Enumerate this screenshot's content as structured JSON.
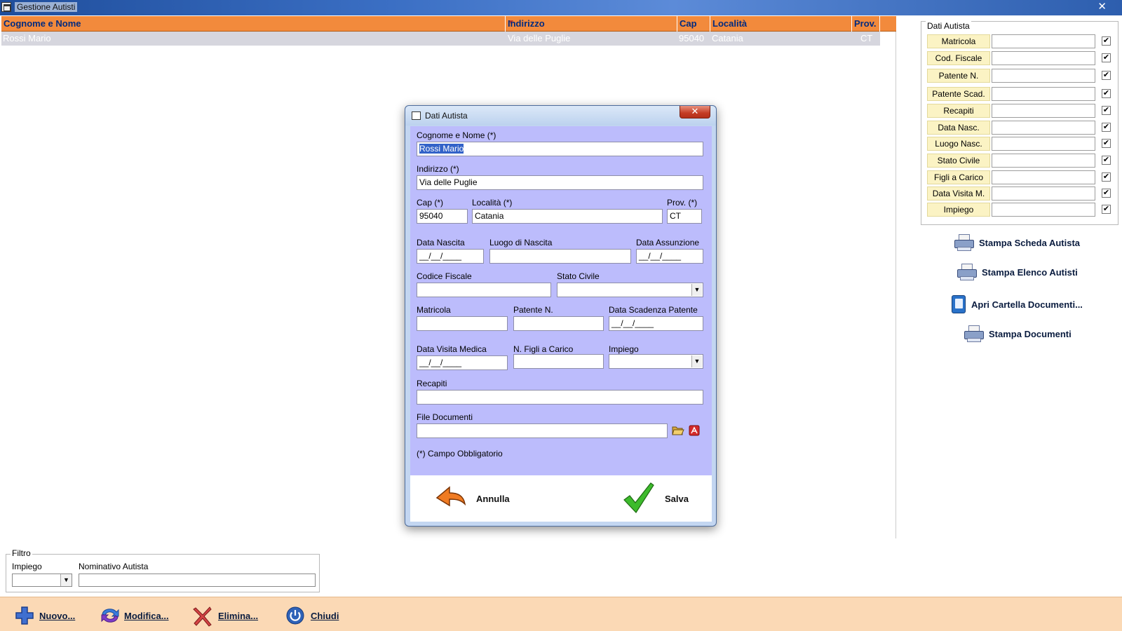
{
  "window": {
    "title": "Gestione Autisti",
    "close_glyph": "✕"
  },
  "grid": {
    "headers": [
      "Cognome e Nome",
      "Indirizzo",
      "Cap",
      "Località",
      "Prov."
    ],
    "rows": [
      {
        "nome": "Rossi Mario",
        "indirizzo": "Via delle Puglie",
        "cap": "95040",
        "localita": "Catania",
        "prov": "CT"
      }
    ]
  },
  "right_panel": {
    "group_title": "Dati Autista",
    "fields": [
      "Matricola",
      "Cod. Fiscale",
      "Patente N.",
      "Patente Scad.",
      "Recapiti",
      "Data Nasc.",
      "Luogo Nasc.",
      "Stato Civile",
      "Figli a Carico",
      "Data Visita M.",
      "Impiego"
    ],
    "check_glyph": "✔",
    "buttons": {
      "stampa_scheda": "Stampa Scheda Autista",
      "stampa_elenco": "Stampa Elenco Autisti",
      "apri_cartella": "Apri Cartella Documenti...",
      "stampa_documenti": "Stampa Documenti"
    }
  },
  "filter": {
    "title": "Filtro",
    "impiego_label": "Impiego",
    "nominativo_label": "Nominativo Autista",
    "impiego_value": "",
    "nominativo_value": ""
  },
  "toolbar": {
    "nuovo": "Nuovo...",
    "modifica": "Modifica...",
    "elimina": "Elimina...",
    "chiudi": "Chiudi"
  },
  "dialog": {
    "title": "Dati Autista",
    "close_glyph": "✕",
    "labels": {
      "nome": "Cognome e Nome (*)",
      "indirizzo": "Indirizzo (*)",
      "cap": "Cap (*)",
      "localita": "Località (*)",
      "prov": "Prov. (*)",
      "data_nascita": "Data Nascita",
      "luogo_nascita": "Luogo di Nascita",
      "data_assunzione": "Data Assunzione",
      "codice_fiscale": "Codice Fiscale",
      "stato_civile": "Stato Civile",
      "matricola": "Matricola",
      "patente": "Patente N.",
      "scadenza_patente": "Data Scadenza Patente",
      "visita_medica": "Data Visita Medica",
      "figli": "N. Figli a Carico",
      "impiego": "Impiego",
      "recapiti": "Recapiti",
      "file_documenti": "File Documenti"
    },
    "values": {
      "nome": "Rossi Mario",
      "indirizzo": "Via delle Puglie",
      "cap": "95040",
      "localita": "Catania",
      "prov": "CT",
      "data_nascita": "__/__/____",
      "luogo_nascita": "",
      "data_assunzione": "__/__/____",
      "codice_fiscale": "",
      "stato_civile": "",
      "matricola": "",
      "patente": "",
      "scadenza_patente": "__/__/____",
      "visita_medica": "__/__/____",
      "figli": "",
      "impiego": "",
      "recapiti": "",
      "file_documenti": ""
    },
    "required_note": "(*) Campo Obbligatorio",
    "annulla": "Annulla",
    "salva": "Salva"
  },
  "colors": {
    "header_orange": "#f28a3c",
    "dialog_body": "#bcbcfc",
    "toolbar_peach": "#fbd9b5",
    "label_yellow": "#fbf3c4"
  }
}
